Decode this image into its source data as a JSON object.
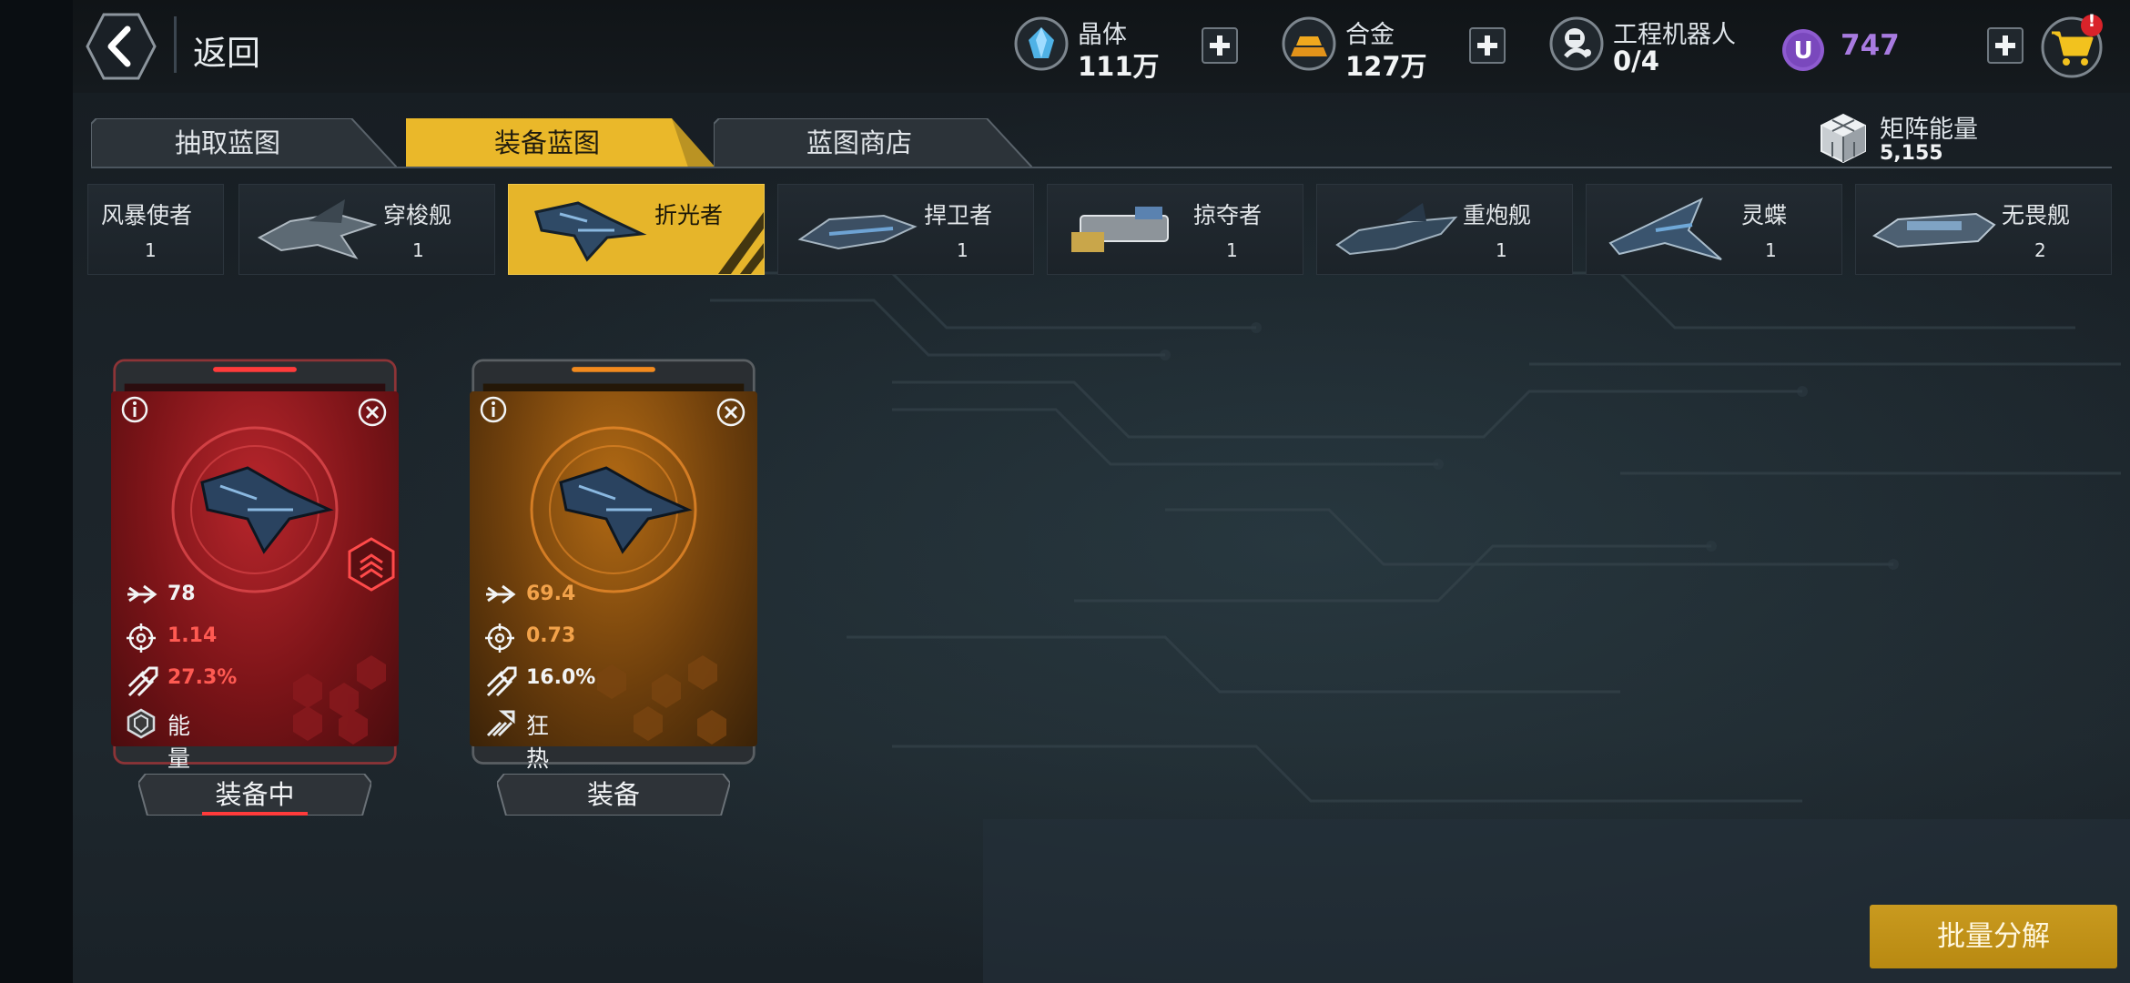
{
  "header": {
    "back_label": "返回",
    "resources": [
      {
        "name": "晶体",
        "value": "111万",
        "icon": "crystal-icon"
      },
      {
        "name": "合金",
        "value": "127万",
        "icon": "alloy-icon"
      },
      {
        "name": "工程机器人",
        "value": "0/4",
        "icon": "robot-icon"
      }
    ],
    "premium_currency": {
      "value": "747",
      "icon": "u-coin-icon",
      "color": "#a87be0"
    },
    "cart_badge": "!"
  },
  "tabs": [
    {
      "label": "抽取蓝图",
      "active": false
    },
    {
      "label": "装备蓝图",
      "active": true
    },
    {
      "label": "蓝图商店",
      "active": false
    }
  ],
  "matrix_energy": {
    "label": "矩阵能量",
    "value": "5,155"
  },
  "ship_types": [
    {
      "name": "风暴使者",
      "count": "1",
      "active": false
    },
    {
      "name": "穿梭舰",
      "count": "1",
      "active": false
    },
    {
      "name": "折光者",
      "count": "1",
      "active": true
    },
    {
      "name": "捍卫者",
      "count": "1",
      "active": false
    },
    {
      "name": "掠夺者",
      "count": "1",
      "active": false
    },
    {
      "name": "重炮舰",
      "count": "1",
      "active": false
    },
    {
      "name": "灵蝶",
      "count": "1",
      "active": false
    },
    {
      "name": "无畏舰",
      "count": "2",
      "active": false
    }
  ],
  "cards": [
    {
      "rarity_color": "#d8262a",
      "stats": [
        {
          "icon": "speed-arrow-icon",
          "value": "78",
          "color": "#f2f4f5"
        },
        {
          "icon": "crosshair-icon",
          "value": "1.14",
          "color": "#ff5a52"
        },
        {
          "icon": "missile-icon",
          "value": "27.3%",
          "color": "#ff5a52"
        }
      ],
      "skill": {
        "icon": "shield-badge-icon",
        "name": "能量盾"
      },
      "button_label": "装备中",
      "rank_icon": "rank-chevron-icon"
    },
    {
      "rarity_color": "#e48a1c",
      "stats": [
        {
          "icon": "speed-arrow-icon",
          "value": "69.4",
          "color": "#f2a24a"
        },
        {
          "icon": "crosshair-icon",
          "value": "0.73",
          "color": "#f2a24a"
        },
        {
          "icon": "missile-icon",
          "value": "16.0%",
          "color": "#f2f4f5"
        }
      ],
      "skill": {
        "icon": "frenzy-icon",
        "name": "狂热"
      },
      "button_label": "装备"
    }
  ],
  "batch_button": "批量分解",
  "colors": {
    "accent_gold": "#e6b52a",
    "panel_dark": "#1c2329"
  }
}
